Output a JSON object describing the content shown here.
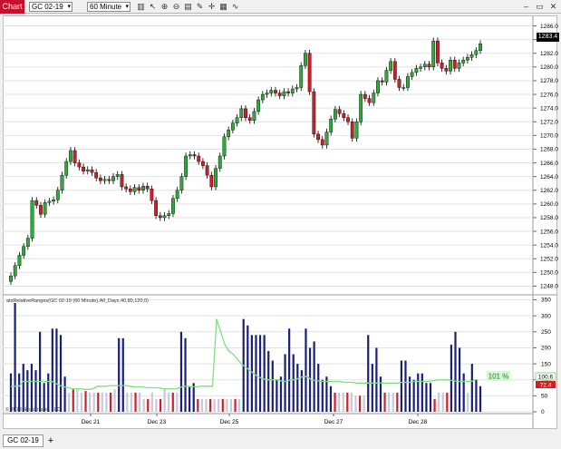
{
  "window": {
    "chart_tab": "Chart",
    "instrument": "GC 02-19",
    "interval": "60 Minute",
    "toolbar_icons": [
      "bar-type-icon",
      "pointer-icon",
      "zoom-in-icon",
      "zoom-out-icon",
      "properties-icon",
      "draw-icon",
      "crosshair-icon",
      "data-box-icon",
      "link-icon"
    ],
    "controls": [
      "minimize-icon",
      "restore-icon",
      "close-icon"
    ]
  },
  "price_panel": {
    "y_ticks": [
      "1286.0",
      "1284.0",
      "1282.0",
      "1280.0",
      "1278.0",
      "1276.0",
      "1274.0",
      "1272.0",
      "1270.0",
      "1268.0",
      "1266.0",
      "1264.0",
      "1262.0",
      "1260.0",
      "1258.0",
      "1256.0",
      "1254.0",
      "1252.0",
      "1250.0",
      "1248.0"
    ],
    "last_price": "1283.4",
    "up_color": "#2eaa3a",
    "down_color": "#d11e26"
  },
  "indicator_panel": {
    "label": "atsRelativeRanges(GC 02-19 (60 Minute),All_Days,40,80,120,0)",
    "y_ticks": [
      "350",
      "300",
      "250",
      "200",
      "150",
      "100",
      "50",
      "0"
    ],
    "value_1": "100.6",
    "value_2": "72.4",
    "percent": "101 %",
    "bar_color": "#1a1f7a",
    "average_color": "#7ee07e",
    "copyright": "© 2018 NinjaTrader, LLC"
  },
  "x_axis": {
    "labels": [
      "Dec 21",
      "Dec 23",
      "Dec 25",
      "Dec 27",
      "Dec 28"
    ]
  },
  "tabs": {
    "active": "GC 02-19",
    "add": "+"
  },
  "chart_data": [
    {
      "type": "candlestick",
      "title": "",
      "ylim": [
        1247,
        1287
      ],
      "x_labels": [
        "Dec 21",
        "Dec 23",
        "Dec 25",
        "Dec 27",
        "Dec 28"
      ],
      "y_ticks": [
        1286,
        1284,
        1282,
        1280,
        1278,
        1276,
        1274,
        1272,
        1270,
        1268,
        1266,
        1264,
        1262,
        1260,
        1258,
        1256,
        1254,
        1252,
        1250,
        1248
      ],
      "last_price": 1283.4,
      "close": [
        1249.5,
        1251.0,
        1252.5,
        1253.8,
        1255.0,
        1260.5,
        1259.8,
        1258.5,
        1260.2,
        1260.4,
        1260.6,
        1262.0,
        1264.2,
        1266.2,
        1267.8,
        1266.0,
        1265.4,
        1264.8,
        1265.0,
        1264.6,
        1263.8,
        1263.4,
        1263.6,
        1263.4,
        1264.0,
        1264.3,
        1262.5,
        1262.2,
        1261.8,
        1262.4,
        1262.0,
        1262.6,
        1262.2,
        1260.5,
        1258.3,
        1258.0,
        1258.3,
        1258.6,
        1260.8,
        1262.0,
        1264.0,
        1267.0,
        1267.2,
        1267.0,
        1266.2,
        1265.6,
        1264.2,
        1262.5,
        1265.2,
        1267.0,
        1269.8,
        1270.8,
        1271.8,
        1272.6,
        1273.9,
        1272.6,
        1272.2,
        1273.5,
        1275.2,
        1276.0,
        1276.2,
        1276.6,
        1276.2,
        1275.8,
        1276.4,
        1276.2,
        1276.8,
        1277.0,
        1280.2,
        1282.0,
        1276.4,
        1270.2,
        1269.4,
        1268.6,
        1270.5,
        1272.4,
        1273.8,
        1273.2,
        1272.6,
        1272.0,
        1269.6,
        1272.0,
        1276.0,
        1275.4,
        1274.8,
        1276.2,
        1278.0,
        1277.8,
        1279.5,
        1280.8,
        1278.2,
        1277.0,
        1277.0,
        1278.6,
        1279.2,
        1279.8,
        1280.0,
        1280.4,
        1280.0,
        1283.8,
        1280.6,
        1279.8,
        1279.4,
        1281.0,
        1279.8,
        1280.6,
        1281.0,
        1281.4,
        1281.8,
        1282.4,
        1283.4
      ],
      "indicator": {
        "type": "bar",
        "ylim": [
          0,
          360
        ],
        "y_ticks": [
          350,
          300,
          250,
          200,
          150,
          100,
          50,
          0
        ],
        "values": [
          120,
          340,
          120,
          150,
          130,
          150,
          130,
          250,
          90,
          120,
          260,
          260,
          240,
          110,
          60,
          70,
          70,
          60,
          65,
          60,
          60,
          60,
          60,
          60,
          60,
          70,
          230,
          230,
          60,
          60,
          60,
          60,
          40,
          40,
          60,
          40,
          40,
          70,
          60,
          60,
          60,
          250,
          230,
          80,
          90,
          40,
          40,
          40,
          40,
          40,
          40,
          40,
          40,
          40,
          40,
          40,
          290,
          270,
          240,
          240,
          240,
          240,
          190,
          160,
          100,
          110,
          180,
          260,
          180,
          150,
          130,
          260,
          200,
          220,
          150,
          100,
          110,
          80,
          60,
          60,
          60,
          60,
          60,
          50,
          50,
          50,
          240,
          150,
          200,
          110,
          60,
          60,
          60,
          60,
          160,
          160,
          110,
          100,
          120,
          120,
          90,
          90,
          40,
          60,
          60,
          60,
          210,
          250,
          200,
          120,
          60,
          150,
          100,
          80
        ],
        "average": [
          80,
          80,
          80,
          95,
          95,
          95,
          95,
          95,
          95,
          95,
          95,
          88,
          82,
          78,
          75,
          72,
          72,
          72,
          70,
          70,
          72,
          80,
          80,
          80,
          82,
          82,
          82,
          82,
          82,
          80,
          78,
          78,
          78,
          75,
          75,
          75,
          75,
          72,
          72,
          72,
          72,
          75,
          80,
          80,
          78,
          78,
          80,
          80,
          80,
          80,
          290,
          250,
          210,
          190,
          180,
          165,
          150,
          140,
          130,
          120,
          110,
          105,
          100,
          100,
          100,
          100,
          95,
          95,
          100,
          100,
          105,
          110,
          110,
          100,
          98,
          96,
          95,
          95,
          95,
          95,
          95,
          92,
          92,
          92,
          90,
          90,
          90,
          90,
          90,
          90,
          90,
          90,
          90,
          90,
          90,
          92,
          92,
          92,
          95,
          95,
          95,
          95,
          96,
          98,
          100,
          100,
          100,
          98,
          96,
          95,
          95,
          95,
          95,
          100.6
        ],
        "last_values": [
          100.6,
          72.4
        ],
        "percent": "101 %"
      }
    }
  ]
}
